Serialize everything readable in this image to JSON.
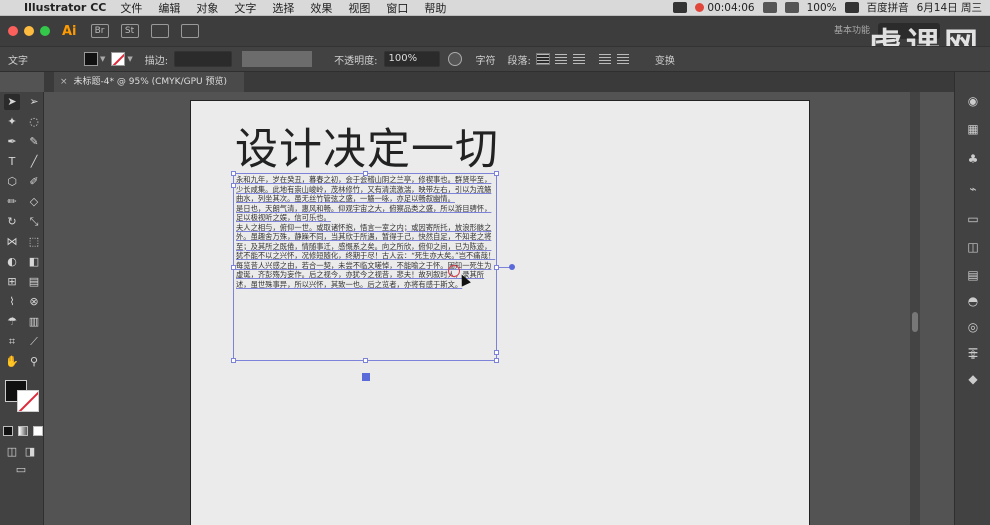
{
  "mac_menu": {
    "apple": "",
    "app_name": "Illustrator CC",
    "items": [
      "文件",
      "编辑",
      "对象",
      "文字",
      "选择",
      "效果",
      "视图",
      "窗口",
      "帮助"
    ],
    "timer": "00:04:06",
    "battery": "100%",
    "input_method": "百度拼音",
    "date": "6月14日 周三"
  },
  "app_bar": {
    "logo": "Ai",
    "br_label": "Br",
    "st_label": "St",
    "workspace": "基本功能",
    "watermark": "虎课网"
  },
  "control_bar": {
    "mode_label": "文字",
    "stroke_label": "描边:",
    "opacity_label": "不透明度:",
    "opacity_value": "100%",
    "char_label": "字符",
    "paragraph_label": "段落:",
    "transform_label": "变换"
  },
  "document_tab": {
    "close": "×",
    "title": "未标题-4* @ 95% (CMYK/GPU 预览)"
  },
  "artboard": {
    "heading": "设计决定一切",
    "paragraphs": [
      "永和九年，岁在癸丑，暮春之初，会于会稽山阴之兰亭，修禊事也。群贤毕至，少长咸集。此地有崇山峻岭，茂林修竹，又有清流激湍，映带左右，引以为流觞曲水，列坐其次。虽无丝竹管弦之盛，一觞一咏，亦足以畅叙幽情。",
      "是日也，天朗气清，惠风和畅。仰观宇宙之大，俯察品类之盛，所以游目骋怀，足以极视听之娱，信可乐也。",
      "夫人之相与，俯仰一世。或取诸怀抱，悟言一室之内；或因寄所托，放浪形骸之外。虽趣舍万殊，静躁不同，当其欣于所遇，暂得于己，快然自足，不知老之将至；及其所之既倦，情随事迁，感慨系之矣。向之所欣，俯仰之间，已为陈迹，犹不能不以之兴怀，况修短随化，终期于尽！古人云：“死生亦大矣。”岂不痛哉！",
      "每览昔人兴感之由，若合一契，未尝不临文嗟悼，不能喻之于怀。固知一死生为虚诞，齐彭殇为妄作。后之视今，亦犹今之视昔，悲夫！故列叙时人，录其所述，虽世殊事异，所以兴怀，其致一也。后之览者，亦将有感于斯文。"
    ]
  },
  "colors": {
    "selection": "#7c83d9",
    "accent_red": "#e0283a"
  }
}
